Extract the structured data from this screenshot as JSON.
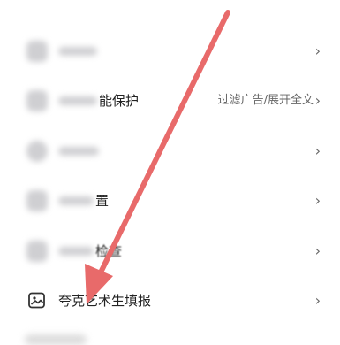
{
  "settings": {
    "rows": [
      {
        "label": "",
        "value": "",
        "chevron": "›"
      },
      {
        "label": "能保护",
        "value": "过滤广告/展开全文",
        "chevron": "›"
      },
      {
        "label": "",
        "value": "",
        "chevron": "›"
      },
      {
        "label": "置",
        "value": "",
        "chevron": "›"
      },
      {
        "label": "检查",
        "value": "",
        "chevron": "›"
      },
      {
        "label": "夸克艺术生填报",
        "value": "",
        "chevron": "›",
        "icon": "image-icon"
      }
    ]
  },
  "annotation": {
    "type": "arrow",
    "color": "#e86a6a"
  },
  "colors": {
    "background": "#ffffff",
    "text": "#222222",
    "secondary_text": "#666666",
    "arrow": "#e86a6a"
  }
}
